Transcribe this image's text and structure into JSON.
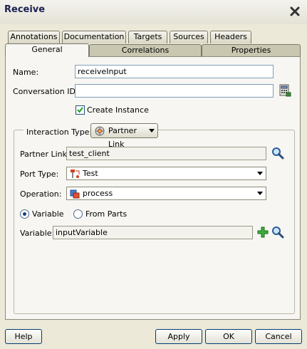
{
  "window": {
    "title": "Receive"
  },
  "tabs": {
    "row1": [
      "Annotations",
      "Documentation",
      "Targets",
      "Sources",
      "Headers"
    ],
    "row2": [
      "General",
      "Correlations",
      "Properties"
    ]
  },
  "form": {
    "name_label": "Name:",
    "name_value": "receiveInput",
    "conversation_label": "Conversation ID:",
    "conversation_value": "",
    "create_instance_label": "Create Instance",
    "create_instance_checked": true,
    "interaction_type_label": "Interaction Type:",
    "interaction_type_value": "Partner Link",
    "partner_link_label": "Partner Link:",
    "partner_link_value": "test_client",
    "port_type_label": "Port Type:",
    "port_type_value": "Test",
    "operation_label": "Operation:",
    "operation_value": "process",
    "radio_variable_label": "Variable",
    "radio_from_parts_label": "From Parts",
    "radio_selected": "Variable",
    "variable_label": "Variable:",
    "variable_value": "inputVariable"
  },
  "buttons": {
    "help": "Help",
    "apply": "Apply",
    "ok": "OK",
    "cancel": "Cancel"
  },
  "icons": [
    "close-icon",
    "expression-builder-icon",
    "partner-link-icon",
    "search-icon",
    "port-type-icon",
    "operation-icon",
    "add-icon"
  ]
}
